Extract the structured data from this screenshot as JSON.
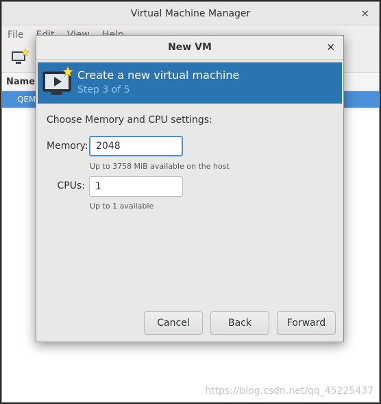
{
  "background_window": {
    "title": "Virtual Machine Manager",
    "menu": [
      "File",
      "Edit",
      "View",
      "Help"
    ],
    "column_header": "Name",
    "selected_row": "QEMU"
  },
  "dialog": {
    "title": "New VM",
    "banner": {
      "title": "Create a new virtual machine",
      "step": "Step 3 of 5"
    },
    "section_label": "Choose Memory and CPU settings:",
    "memory": {
      "label": "Memory:",
      "value": "2048",
      "hint": "Up to 3758 MiB available on the host"
    },
    "cpus": {
      "label": "CPUs:",
      "value": "1",
      "hint": "Up to 1 available"
    },
    "buttons": {
      "cancel": "Cancel",
      "back": "Back",
      "forward": "Forward"
    }
  },
  "watermark": "https://blog.csdn.net/qq_45225437",
  "colors": {
    "banner_bg": "#2a75b1",
    "selection": "#4a90d9",
    "focus": "#4a90d9"
  }
}
